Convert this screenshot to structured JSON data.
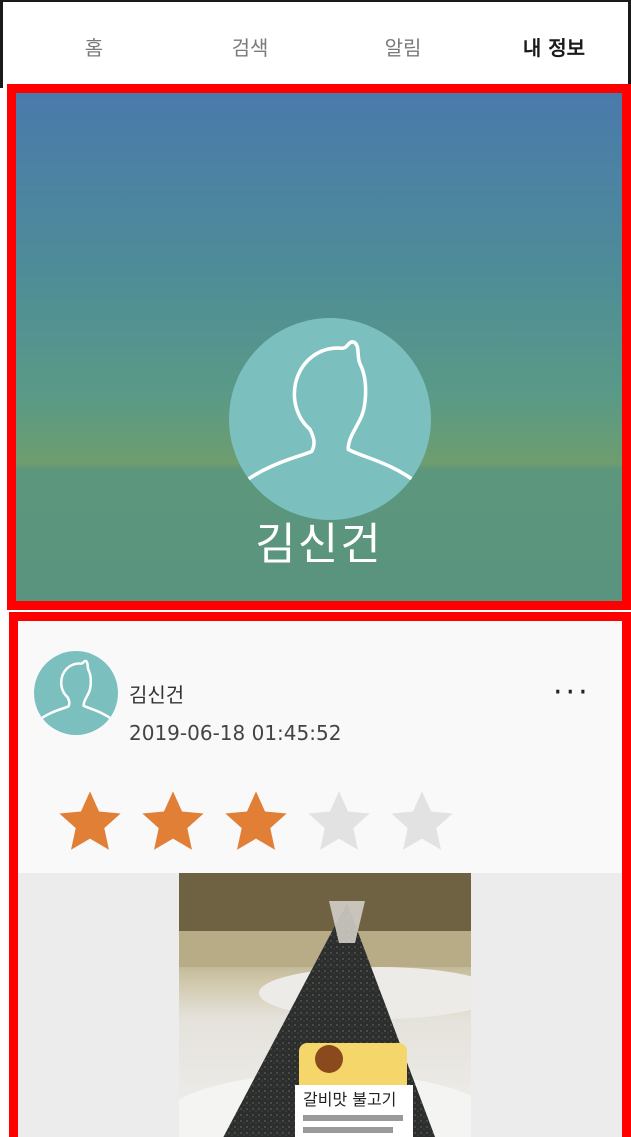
{
  "tabs": [
    {
      "label": "홈",
      "active": false
    },
    {
      "label": "검색",
      "active": false
    },
    {
      "label": "알림",
      "active": false
    },
    {
      "label": "내 정보",
      "active": true
    }
  ],
  "profile": {
    "name": "김신건"
  },
  "post": {
    "author": "김신건",
    "timestamp": "2019-06-18 01:45:52",
    "more_label": "···",
    "rating": 3,
    "rating_max": 5,
    "photo": {
      "label_text": "갈비맛 불고기"
    }
  },
  "colors": {
    "accent_star": "#e07f35",
    "empty_star": "#e2e2e2",
    "avatar_bg": "#7bc0bf",
    "highlight_border": "#ff0000"
  },
  "icons": [
    "person-silhouette-icon",
    "star-icon",
    "more-options-icon"
  ]
}
